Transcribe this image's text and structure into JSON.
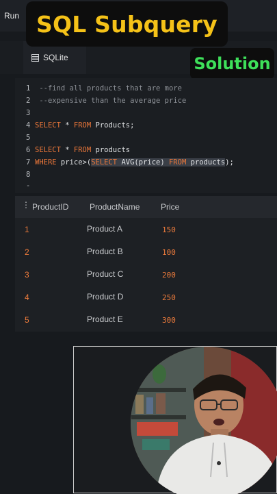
{
  "toolbar": {
    "run_label": "Run"
  },
  "overlay": {
    "title": "SQL Subquery",
    "badge": "Solution"
  },
  "tab": {
    "label": "SQLite",
    "icon": "database-icon"
  },
  "editor": {
    "lines": [
      {
        "num": "1",
        "comment": "--find all products that are more"
      },
      {
        "num": "2",
        "comment": "--expensive than the average price"
      },
      {
        "num": "3"
      },
      {
        "num": "4",
        "kw1": "SELECT",
        "t1": " * ",
        "kw2": "FROM",
        "t2": " Products;"
      },
      {
        "num": "5"
      },
      {
        "num": "6",
        "kw1": "SELECT",
        "t1": " * ",
        "kw2": "FROM",
        "t2": " products"
      },
      {
        "num": "7",
        "kw1": "WHERE",
        "t1": " price>(",
        "kw2": "SELECT",
        "t2": " AVG(price) ",
        "kw3": "FROM",
        "t3": " products",
        "t4": ");"
      },
      {
        "num": "8"
      },
      {
        "num": "-"
      }
    ]
  },
  "results": {
    "menu_icon": "⋮",
    "columns": [
      "ProductID",
      "ProductName",
      "Price"
    ],
    "rows": [
      {
        "id": "1",
        "name": "Product A",
        "price": "150"
      },
      {
        "id": "2",
        "name": "Product B",
        "price": "100"
      },
      {
        "id": "3",
        "name": "Product C",
        "price": "200"
      },
      {
        "id": "4",
        "name": "Product D",
        "price": "250"
      },
      {
        "id": "5",
        "name": "Product E",
        "price": "300"
      }
    ]
  },
  "colors": {
    "keyword": "#f0793a",
    "title": "#f5c218",
    "badge": "#3ee05a"
  }
}
